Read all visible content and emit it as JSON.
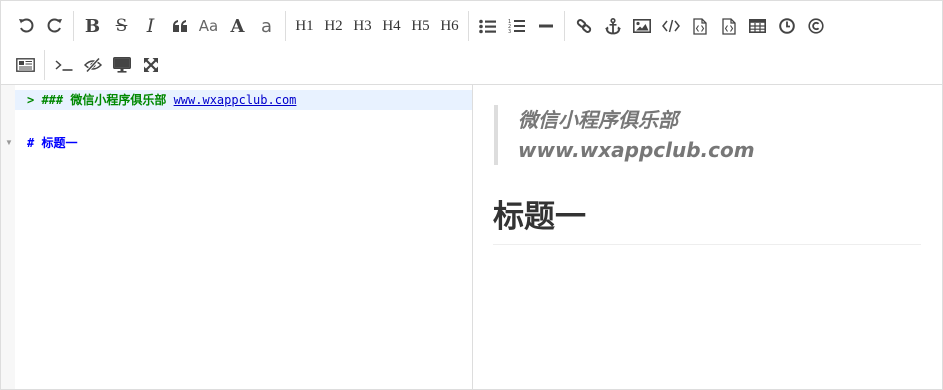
{
  "toolbar": {
    "row1": [
      {
        "name": "undo-button",
        "icon": "undo-icon"
      },
      {
        "name": "redo-button",
        "icon": "redo-icon"
      },
      {
        "sep": true
      },
      {
        "name": "bold-button",
        "label": "B"
      },
      {
        "name": "strikethrough-button",
        "label": "S"
      },
      {
        "name": "italic-button",
        "label": "I"
      },
      {
        "name": "quote-button",
        "icon": "quote-icon"
      },
      {
        "name": "uppercase-button",
        "label": "Aa"
      },
      {
        "name": "uppercase-all-button",
        "label": "A"
      },
      {
        "name": "lowercase-button",
        "label": "a"
      },
      {
        "sep": true
      },
      {
        "name": "h1-button",
        "label": "H1"
      },
      {
        "name": "h2-button",
        "label": "H2"
      },
      {
        "name": "h3-button",
        "label": "H3"
      },
      {
        "name": "h4-button",
        "label": "H4"
      },
      {
        "name": "h5-button",
        "label": "H5"
      },
      {
        "name": "h6-button",
        "label": "H6"
      },
      {
        "sep": true
      },
      {
        "name": "unordered-list-button",
        "icon": "list-ul-icon"
      },
      {
        "name": "ordered-list-button",
        "icon": "list-ol-icon"
      },
      {
        "name": "horizontal-rule-button",
        "icon": "minus-icon"
      },
      {
        "sep": true
      },
      {
        "name": "link-button",
        "icon": "link-icon"
      },
      {
        "name": "anchor-button",
        "icon": "anchor-icon"
      },
      {
        "name": "image-button",
        "icon": "image-icon"
      },
      {
        "name": "code-button",
        "icon": "code-icon"
      },
      {
        "name": "preformatted-code-button",
        "icon": "file-code-icon"
      },
      {
        "name": "code-block-button",
        "icon": "file-code-icon"
      },
      {
        "name": "table-button",
        "icon": "table-icon"
      },
      {
        "name": "datetime-button",
        "icon": "clock-icon"
      },
      {
        "name": "html-entities-button",
        "icon": "copyright-icon"
      }
    ],
    "row2": [
      {
        "name": "pagebreak-button",
        "icon": "newspaper-icon"
      },
      {
        "sep": true
      },
      {
        "name": "goto-line-button",
        "icon": "terminal-icon"
      },
      {
        "name": "watch-toggle-button",
        "icon": "eye-slash-icon"
      },
      {
        "name": "preview-button",
        "icon": "desktop-icon"
      },
      {
        "name": "fullscreen-button",
        "icon": "arrows-alt-icon"
      }
    ]
  },
  "code": {
    "line1_quote": "> ### 微信小程序俱乐部 ",
    "line1_link": "www.wxappclub.com",
    "line3": "# 标题一"
  },
  "preview": {
    "quote_line1": "微信小程序俱乐部",
    "quote_line2": "www.wxappclub.com",
    "h1": "标题一"
  }
}
